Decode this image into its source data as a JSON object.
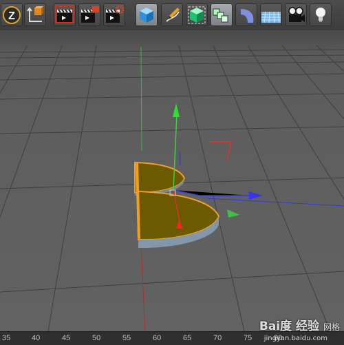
{
  "toolbar": {
    "tools": [
      {
        "name": "undo-z",
        "icon": "z-undo-icon",
        "label": "Z"
      },
      {
        "name": "coordinate-system",
        "icon": "axis-cube-icon"
      },
      {
        "name": "render-view",
        "icon": "clapboard-render-view-icon"
      },
      {
        "name": "render-picture-viewer",
        "icon": "clapboard-picture-viewer-icon"
      },
      {
        "name": "render-settings",
        "icon": "clapboard-gear-icon"
      },
      {
        "name": "primitive-cube",
        "icon": "cube-icon"
      },
      {
        "name": "spline-pen",
        "icon": "pen-icon"
      },
      {
        "name": "generator-subdivision",
        "icon": "green-cube-icon"
      },
      {
        "name": "modeling-array",
        "icon": "array-cubes-icon"
      },
      {
        "name": "deformer-bend",
        "icon": "bend-icon"
      },
      {
        "name": "environment-floor",
        "icon": "floor-icon"
      },
      {
        "name": "camera",
        "icon": "camera-icon"
      },
      {
        "name": "light",
        "icon": "lightbulb-icon"
      }
    ]
  },
  "ruler": {
    "labels": [
      "35",
      "40",
      "45",
      "50",
      "55",
      "60",
      "65",
      "70",
      "75",
      "80"
    ]
  },
  "watermark": {
    "text": "Bai度 经验",
    "url": "jingyan.baidu.com",
    "side": "网格"
  },
  "colors": {
    "accent_orange": "#f0a020",
    "axis_x": "#3030ff",
    "axis_y": "#30c030",
    "axis_z": "#c02020",
    "object_fill": "#6b5a00"
  }
}
